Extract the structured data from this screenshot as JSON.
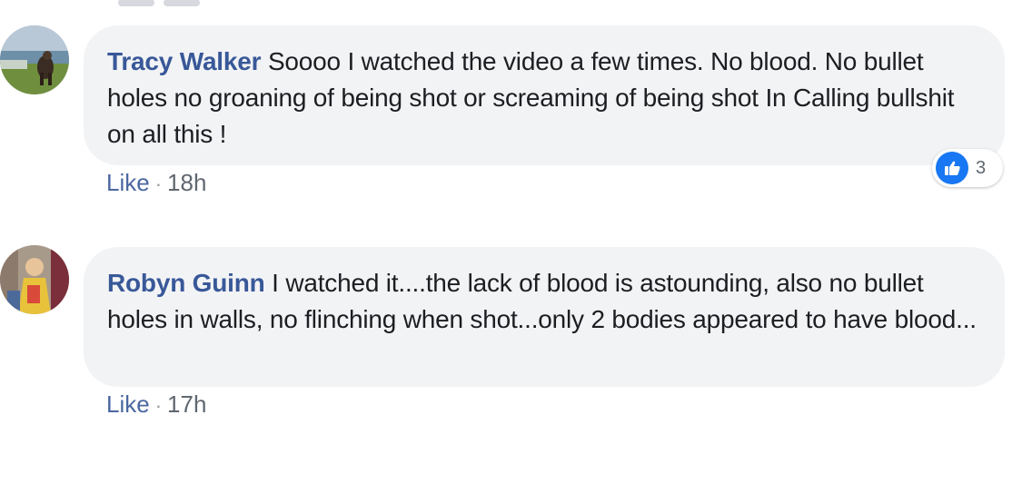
{
  "comments": [
    {
      "author": "Tracy Walker",
      "text": "Soooo I watched the video a few times. No blood. No bullet holes no groaning of being shot or screaming of being shot In Calling bullshit on all this !",
      "like_label": "Like",
      "separator": "·",
      "time": "18h",
      "reaction_icon": "thumbs-up-icon",
      "reaction_count": "3"
    },
    {
      "author": "Robyn Guinn",
      "text": "I watched it....the lack of blood is astounding, also no bullet holes in walls, no flinching when shot...only 2 bodies appeared to have blood...",
      "like_label": "Like",
      "separator": "·",
      "time": "17h"
    }
  ],
  "colors": {
    "author": "#385898",
    "bubble": "#f2f3f5",
    "like_badge": "#1877f2"
  }
}
